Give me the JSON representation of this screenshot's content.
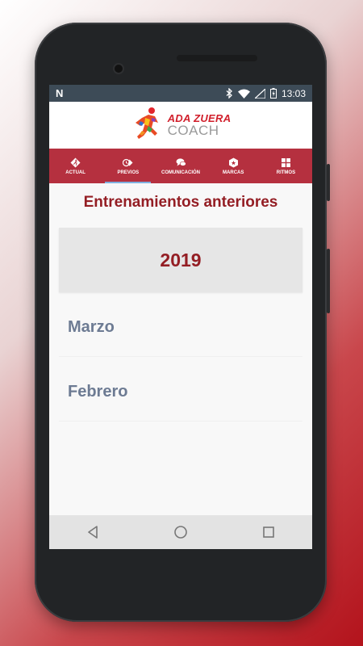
{
  "status_bar": {
    "notification_icon": "N",
    "time": "13:03"
  },
  "brand": {
    "line1": "ADA ZUERA",
    "line2": "COACH"
  },
  "tabs": [
    {
      "label": "ACTUAL",
      "icon": "runner-icon",
      "active": false
    },
    {
      "label": "PREVIOS",
      "icon": "history-icon",
      "active": true
    },
    {
      "label": "COMUNICACIÓN",
      "icon": "chat-icon",
      "active": false
    },
    {
      "label": "MARCAS",
      "icon": "medal-icon",
      "active": false
    },
    {
      "label": "RITMOS",
      "icon": "grid-icon",
      "active": false
    }
  ],
  "page": {
    "title": "Entrenamientos anteriores",
    "year": "2019",
    "months": [
      "Marzo",
      "Febrero"
    ]
  },
  "colors": {
    "tab_bar": "#b5303f",
    "title": "#941e24",
    "month_text": "#6d7b93",
    "status_bar": "#3d4b57"
  }
}
